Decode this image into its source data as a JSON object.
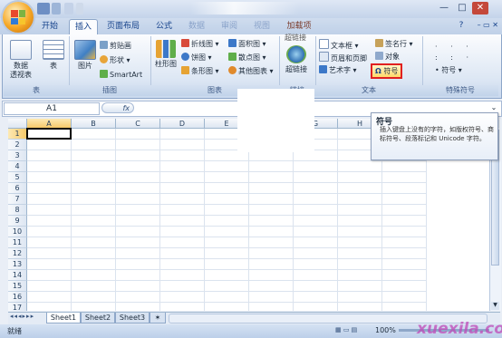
{
  "title_bar": {
    "right_buttons": [
      "▾",
      "—",
      "□",
      "✕"
    ]
  },
  "tabs": [
    {
      "label": "开始",
      "active": false
    },
    {
      "label": "插入",
      "active": true
    },
    {
      "label": "页面布局",
      "active": false
    },
    {
      "label": "公式",
      "active": false
    },
    {
      "label": "数据",
      "active": false
    },
    {
      "label": "审阅",
      "active": false
    },
    {
      "label": "视图",
      "active": false
    },
    {
      "label": "加载项",
      "active": false
    }
  ],
  "ribbon": {
    "groups": {
      "table": {
        "label": "表",
        "pivot": "数据\n透视表",
        "table": "表"
      },
      "illustrations": {
        "label": "插图",
        "picture": "图片",
        "clipart": "剪贴画",
        "shapes": "形状",
        "smartart": "SmartArt"
      },
      "charts": {
        "label": "图表",
        "column": "柱形图",
        "line": "折线图",
        "pie": "饼图",
        "bar": "条形图",
        "area": "面积图",
        "scatter": "散点图",
        "other": "其他图表"
      },
      "links": {
        "label": "链接",
        "hyperlink_top": "超链接",
        "hyperlink": "超链接"
      },
      "text": {
        "label": "文本",
        "textbox": "文本框",
        "header_footer": "页眉和页脚",
        "wordart": "艺术字",
        "signature": "签名行",
        "object": "对象",
        "symbol": "符号"
      },
      "special": {
        "label": "特殊符号",
        "symbol": "符号"
      }
    }
  },
  "formula_bar": {
    "name_box": "A1",
    "fx": "fx",
    "value": ""
  },
  "grid": {
    "columns": [
      "A",
      "B",
      "C",
      "D",
      "E",
      "F",
      "G",
      "H",
      "I"
    ],
    "rows": [
      "1",
      "2",
      "3",
      "4",
      "5",
      "6",
      "7",
      "8",
      "9",
      "10",
      "11",
      "12",
      "13",
      "14",
      "15",
      "16",
      "17"
    ],
    "selected": "A1"
  },
  "sheets": [
    {
      "label": "Sheet1",
      "active": true
    },
    {
      "label": "Sheet2",
      "active": false
    },
    {
      "label": "Sheet3",
      "active": false
    }
  ],
  "status": {
    "left": "就绪",
    "zoom": "100%"
  },
  "tooltip": {
    "title": "符号",
    "body": "插入键盘上没有的字符，如版权符号、商标符号、段落标记和 Unicode 字符。"
  },
  "watermark": "xuexila.com",
  "colors": {
    "accent": "#15428b",
    "highlight": "#e02020",
    "watermark": "#c04ab8"
  }
}
